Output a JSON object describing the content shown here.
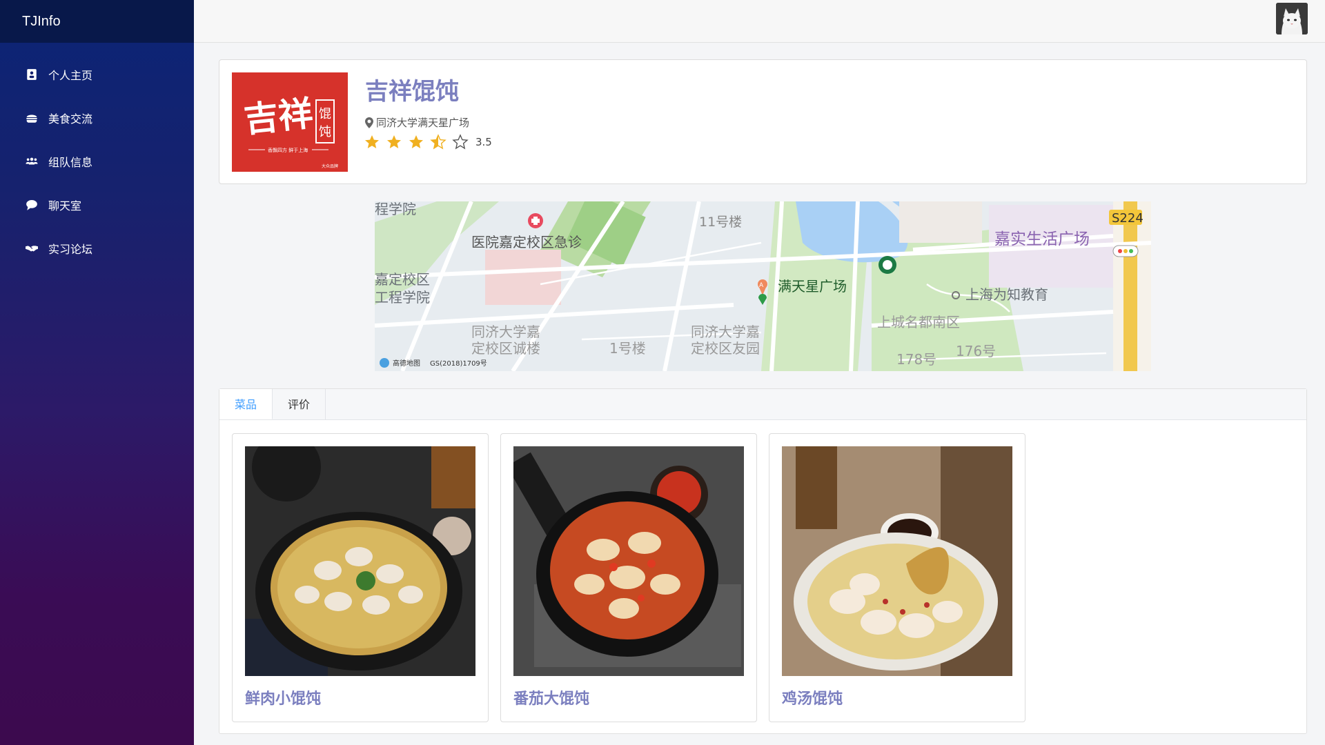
{
  "app": {
    "brand": "TJInfo"
  },
  "sidebar": {
    "items": [
      {
        "label": "个人主页",
        "icon": "profile-card-icon"
      },
      {
        "label": "美食交流",
        "icon": "burger-icon"
      },
      {
        "label": "组队信息",
        "icon": "users-icon"
      },
      {
        "label": "聊天室",
        "icon": "chat-bubble-icon"
      },
      {
        "label": "实习论坛",
        "icon": "handshake-icon"
      }
    ]
  },
  "restaurant": {
    "name": "吉祥馄饨",
    "address": "同济大学满天星广场",
    "rating": 3.5,
    "rating_label": "3.5",
    "logo": {
      "main_text": "吉祥",
      "side_text": "馄饨",
      "tagline": "香飘四方 鲜于上海",
      "mark": "大众品牌"
    }
  },
  "map": {
    "labels": [
      "程学院",
      "医院嘉定校区急诊",
      "11号楼",
      "满天星广场",
      "嘉实生活广场",
      "S224",
      "嘉定校区",
      "工程学院",
      "上海为知教育",
      "同济大学嘉",
      "定校区诚楼",
      "1号楼",
      "同济大学嘉",
      "定校区友园",
      "上城名都南区",
      "178号",
      "176号",
      "高德地图",
      "GS(2018)1709号"
    ],
    "marker_letter": "A"
  },
  "tabs": [
    {
      "label": "菜品",
      "active": true
    },
    {
      "label": "评价",
      "active": false
    }
  ],
  "dishes": [
    {
      "name": "鲜肉小馄饨"
    },
    {
      "name": "番茄大馄饨"
    },
    {
      "name": "鸡汤馄饨"
    }
  ],
  "colors": {
    "accent": "#7b7fbf",
    "tab_active": "#409eff",
    "star": "#f0b020",
    "logo_red": "#d6322b"
  }
}
